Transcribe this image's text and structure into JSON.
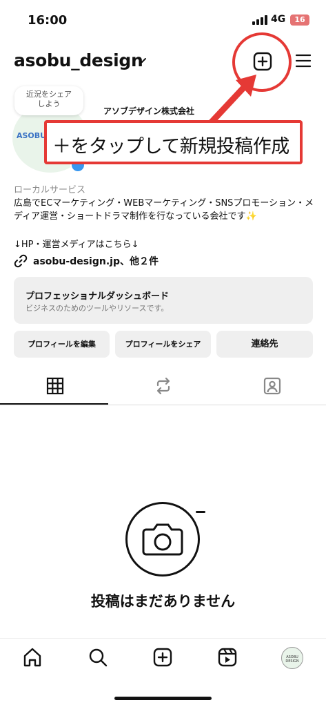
{
  "status_bar": {
    "time": "16:00",
    "network": "4G",
    "battery": "16"
  },
  "header": {
    "username": "asobu_design"
  },
  "annotation": {
    "callout_text": "＋をタップして新規投稿作成",
    "highlight_color": "#e53935"
  },
  "profile": {
    "note_bubble": "近況をシェア\nしよう",
    "avatar_text": "ASOBU",
    "display_name": "アソブデザイン株式会社",
    "category": "ローカルサービス",
    "bio": "広島でECマーケティング・WEBマーケティング・SNSプロモーション・メディア運営・ショートドラマ制作を行なっている会社です✨",
    "bio_link_line": "↓HP・運営メディアはこちら↓",
    "link_text": "asobu-design.jp、他２件"
  },
  "dashboard": {
    "title": "プロフェッショナルダッシュボード",
    "subtitle": "ビジネスのためのツールやリソースです。"
  },
  "buttons": {
    "edit": "プロフィールを編集",
    "share": "プロフィールをシェア",
    "contact": "連絡先"
  },
  "tabs": [
    {
      "icon": "grid-icon",
      "active": true
    },
    {
      "icon": "reposts-icon",
      "active": false
    },
    {
      "icon": "tagged-icon",
      "active": false
    }
  ],
  "empty_state": {
    "text": "投稿はまだありません"
  },
  "bottom_nav": {
    "items": [
      "home-icon",
      "search-icon",
      "create-icon",
      "reels-icon",
      "profile-avatar"
    ],
    "profile_avatar_text": "ASOBU DESIGN"
  },
  "colors": {
    "accent_red": "#e53935",
    "verified_blue": "#3897f0",
    "button_bg": "#efefef"
  }
}
